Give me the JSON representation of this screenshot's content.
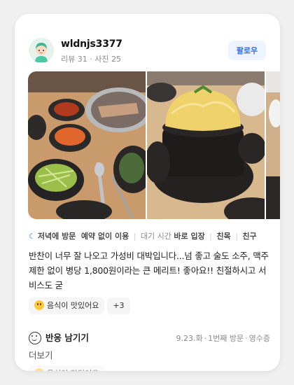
{
  "profile": {
    "username": "wldnjs3377",
    "reviews": "리뷰 31",
    "photos": "사진 25",
    "dot": "·",
    "follow_label": "팔로우"
  },
  "visit_info": [
    {
      "text": "저녁에 방문",
      "strong": true
    },
    {
      "text": "예약 없이 이용",
      "strong": true
    },
    {
      "text": "대기 시간",
      "strong": false
    },
    {
      "text": "바로 입장",
      "strong": true
    },
    {
      "text": "친목",
      "strong": true
    },
    {
      "text": "친구",
      "strong": true
    }
  ],
  "review_text": "반찬이 너무 잘 나오고 가성비 대박입니다...넘 좋고 술도 소주, 맥주 제한 없이 병당 1,800원이라는 큰 메리트! 좋아요!! 친절하시고 서비스도 굳",
  "tags": {
    "first": "음식이 맛있어요",
    "more": "+3"
  },
  "reaction": {
    "label": "반응 남기기"
  },
  "meta": {
    "date": "9.23.화",
    "visit_count": "1번째 방문",
    "verify": "영수증"
  },
  "more_label": "더보기",
  "colors": {
    "accent": "#2b6df2",
    "follow_bg": "#eef4ff",
    "muted": "#8a8a8a"
  },
  "icons": {
    "moon": "moon-icon",
    "smile": "smile-icon",
    "tag_face": "tasty-face-icon"
  }
}
